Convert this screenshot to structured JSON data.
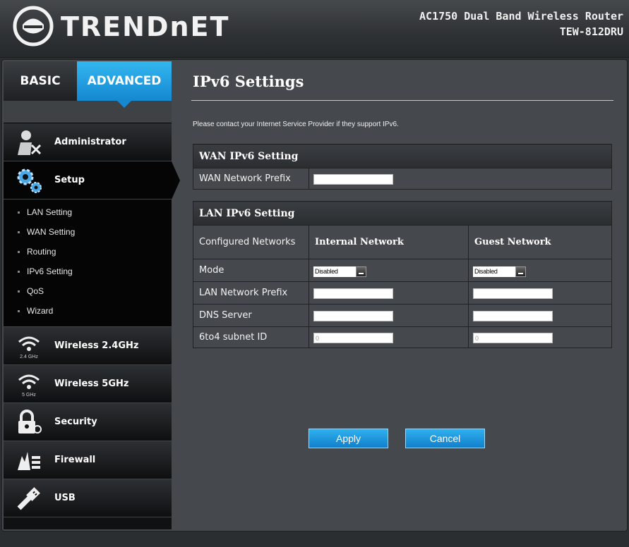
{
  "header": {
    "brand": "TRENDnET",
    "product_line": "AC1750 Dual Band Wireless Router",
    "model": "TEW-812DRU"
  },
  "tabs": {
    "basic": "BASIC",
    "advanced": "ADVANCED",
    "active": "ADVANCED"
  },
  "sidebar": {
    "items": [
      {
        "label": "Administrator",
        "icon": "administrator-icon"
      },
      {
        "label": "Setup",
        "icon": "gears-icon",
        "active": true
      },
      {
        "label": "Wireless 2.4GHz",
        "icon": "wifi-icon",
        "icon_caption": "2.4 GHz"
      },
      {
        "label": "Wireless 5GHz",
        "icon": "wifi-icon",
        "icon_caption": "5 GHz"
      },
      {
        "label": "Security",
        "icon": "lock-icon"
      },
      {
        "label": "Firewall",
        "icon": "firewall-icon"
      },
      {
        "label": "USB",
        "icon": "usb-icon"
      }
    ],
    "setup_submenu": [
      "LAN Setting",
      "WAN Setting",
      "Routing",
      "IPv6 Setting",
      "QoS",
      "Wizard"
    ]
  },
  "main": {
    "title": "IPv6 Settings",
    "note": "Please contact your Internet Service Provider if they support IPv6.",
    "wan": {
      "heading": "WAN IPv6 Setting",
      "prefix_label": "WAN Network Prefix",
      "prefix_value": ""
    },
    "lan": {
      "heading": "LAN IPv6 Setting",
      "configured_label": "Configured Networks",
      "internal_header": "Internal Network",
      "guest_header": "Guest Network",
      "mode_label": "Mode",
      "internal_mode": "Disabled",
      "guest_mode": "Disabled",
      "prefix_label": "LAN Network Prefix",
      "dns_label": "DNS Server",
      "subnet_label": "6to4 subnet ID",
      "internal_subnet": "0",
      "guest_subnet": "0"
    },
    "buttons": {
      "apply": "Apply",
      "cancel": "Cancel"
    }
  },
  "colors": {
    "accent": "#1a9ae0",
    "background": "#45494d",
    "sidebar": "#101112"
  }
}
